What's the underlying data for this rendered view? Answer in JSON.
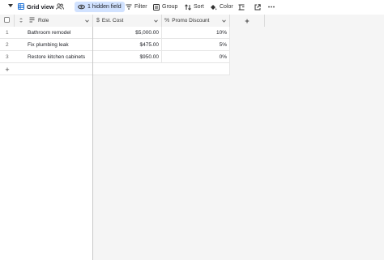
{
  "toolbar": {
    "view_name": "Grid view",
    "hidden_fields_label": "1 hidden field",
    "filter_label": "Filter",
    "group_label": "Group",
    "sort_label": "Sort",
    "color_label": "Color"
  },
  "colors": {
    "hidden_field_bg": "#d1e2ff",
    "grid_bg": "#f5f5f5",
    "view_icon": "#1a6fd6"
  },
  "icons": [
    "chevron-down-icon",
    "grid-view-icon",
    "collaborators-icon",
    "eye-icon",
    "filter-icon",
    "group-icon",
    "sort-icon",
    "color-bucket-icon",
    "row-height-icon",
    "share-icon",
    "more-icon",
    "checkbox-icon",
    "sort-arrows-icon",
    "text-field-icon",
    "currency-icon",
    "percent-icon",
    "plus-icon"
  ],
  "columns": [
    {
      "label": "Role"
    },
    {
      "label": "Est. Cost"
    },
    {
      "label": "Promo Discount"
    }
  ],
  "add_column_label": "+",
  "rows": [
    {
      "num": "1",
      "role": "Bathroom remodel",
      "cost": "$5,000.00",
      "discount": "10%"
    },
    {
      "num": "2",
      "role": "Fix plumbing leak",
      "cost": "$475.00",
      "discount": "5%"
    },
    {
      "num": "3",
      "role": "Restore kitchen cabinets",
      "cost": "$950.00",
      "discount": "0%"
    }
  ],
  "add_row_label": "+"
}
